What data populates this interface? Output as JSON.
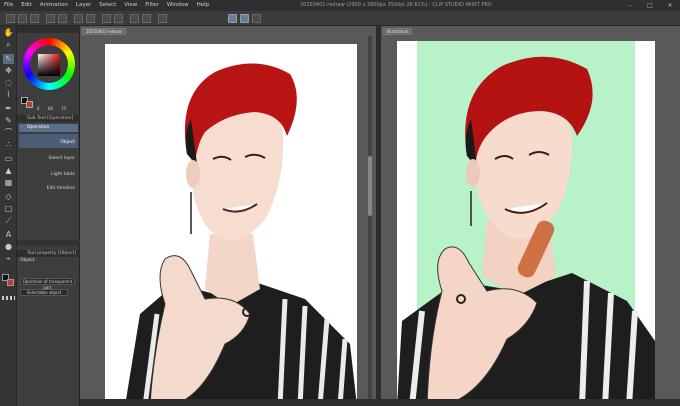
{
  "window": {
    "title": "20250401-redraw (2900 x 3800px 350dpi 26.61%) - CLIP STUDIO PAINT PRO",
    "controls": [
      "–",
      "□",
      "✕"
    ]
  },
  "menu": [
    "File",
    "Edit",
    "Animation",
    "Layer",
    "Select",
    "View",
    "Filter",
    "Window",
    "Help"
  ],
  "toolbar": {
    "buttons": [
      "new",
      "open",
      "save",
      "undo",
      "redo",
      "clear",
      "fill",
      "transform",
      "rotate",
      "select-all",
      "deselect",
      "snap1",
      "snap2",
      "snap3",
      "ruler",
      "grid"
    ]
  },
  "tools": [
    "hand-icon",
    "zoom-icon",
    "move-icon",
    "operation-icon",
    "lasso-icon",
    "eyedropper-icon",
    "pen-icon",
    "pencil-icon",
    "brush-icon",
    "airbrush-icon",
    "eraser-icon",
    "fill-icon",
    "gradient-icon",
    "figure-icon",
    "frame-icon",
    "ruler-icon",
    "text-icon",
    "balloon-icon",
    "correct-line-icon"
  ],
  "color": {
    "hsv_labels": [
      "0",
      "86",
      "74"
    ],
    "foreground": "#0c0c0c",
    "background": "#b93a3a"
  },
  "sub_tool": {
    "header": "Sub Tool [Operation]",
    "group": "Operation",
    "items": [
      "Object",
      "Select layer",
      "Light table",
      "Edit timeline"
    ]
  },
  "tool_property": {
    "header": "Tool property [Object]",
    "section": "Object",
    "mode_dropdown": "Operation of transparent part",
    "select_dropdown": "Selectable object"
  },
  "documents": [
    {
      "tab": "20250401-redraw",
      "background": "#ffffff"
    },
    {
      "tab": "Illustration",
      "background": "#b8f2c8"
    }
  ]
}
